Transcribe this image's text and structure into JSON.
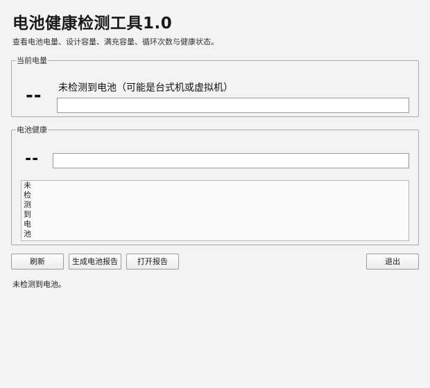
{
  "app": {
    "title": "电池健康检测工具1.0",
    "subtitle": "查看电池电量、设计容量、满充容量、循环次数与健康状态。"
  },
  "current_charge": {
    "legend": "当前电量",
    "value": "--",
    "message": "未检测到电池（可能是台式机或虚拟机）",
    "progress": 0
  },
  "battery_health": {
    "legend": "电池健康",
    "value": "--",
    "progress": 0,
    "details_lines": [
      "未",
      "检",
      "测",
      "到",
      "电",
      "池"
    ]
  },
  "buttons": {
    "refresh": "刷新",
    "generate_report": "生成电池报告",
    "open_report": "打开报告",
    "exit": "退出"
  },
  "status_bar": {
    "text": "未检测到电池。"
  },
  "colors": {
    "background": "#f3f3f3",
    "border": "#a9a9a9",
    "field_bg": "#ffffff"
  }
}
